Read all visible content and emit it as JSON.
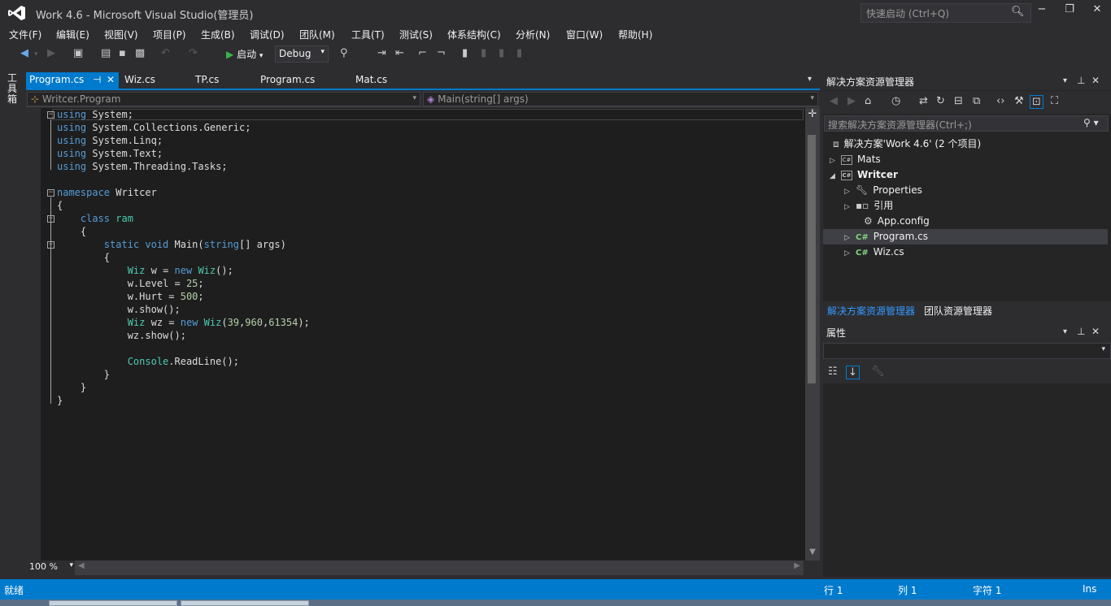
{
  "window": {
    "title": "Work 4.6 - Microsoft Visual Studio(管理员)",
    "quick_launch_placeholder": "快速启动 (Ctrl+Q)",
    "minimize": "−",
    "maximize": "❐",
    "close": "✕"
  },
  "menu": [
    "文件(F)",
    "编辑(E)",
    "视图(V)",
    "项目(P)",
    "生成(B)",
    "调试(D)",
    "团队(M)",
    "工具(T)",
    "测试(S)",
    "体系结构(C)",
    "分析(N)",
    "窗口(W)",
    "帮助(H)"
  ],
  "toolbar": {
    "start_label": "启动",
    "configuration": "Debug"
  },
  "toolbox_label": "工具箱",
  "tabs": [
    {
      "label": "Program.cs",
      "active": true
    },
    {
      "label": "Wiz.cs"
    },
    {
      "label": "TP.cs"
    },
    {
      "label": "Program.cs"
    },
    {
      "label": "Mat.cs"
    }
  ],
  "navbar": {
    "type": "Writcer.Program",
    "member": "Main(string[] args)"
  },
  "code": [
    "using System;",
    "using System.Collections.Generic;",
    "using System.Linq;",
    "using System.Text;",
    "using System.Threading.Tasks;",
    "",
    "namespace Writcer",
    "{",
    "    class Program",
    "    {",
    "        static void Main(string[] args)",
    "        {",
    "            Wiz w = new Wiz();",
    "            w.Level = 25;",
    "            w.Hurt = 500;",
    "            w.show();",
    "            Wiz wz = new Wiz(39,960,61354);",
    "            wz.show();",
    "",
    "            Console.ReadLine();",
    "        }",
    "    }",
    "}"
  ],
  "zoom": "100 %",
  "solution_explorer": {
    "title": "解决方案资源管理器",
    "search_placeholder": "搜索解决方案资源管理器(Ctrl+;)",
    "solution": "解决方案'Work 4.6' (2 个项目)",
    "items": [
      {
        "label": "Mats",
        "level": 1,
        "expander": "collapsed",
        "icon": "csharp-project-icon"
      },
      {
        "label": "Writcer",
        "level": 1,
        "expander": "expanded",
        "icon": "csharp-project-icon",
        "bold": true
      },
      {
        "label": "Properties",
        "level": 2,
        "expander": "collapsed",
        "icon": "wrench-icon"
      },
      {
        "label": "引用",
        "level": 2,
        "expander": "collapsed",
        "icon": "references-icon"
      },
      {
        "label": "App.config",
        "level": 2,
        "expander": "none",
        "icon": "config-file-icon"
      },
      {
        "label": "Program.cs",
        "level": 2,
        "expander": "collapsed",
        "icon": "csharp-file-icon",
        "selected": true
      },
      {
        "label": "Wiz.cs",
        "level": 2,
        "expander": "collapsed",
        "icon": "csharp-file-icon"
      }
    ],
    "bottom_tabs": [
      "解决方案资源管理器",
      "团队资源管理器"
    ]
  },
  "properties": {
    "title": "属性"
  },
  "status": {
    "ready": "就绪",
    "line": "行 1",
    "column": "列 1",
    "char": "字符 1",
    "mode": "Ins"
  },
  "colors": {
    "accent": "#007acc",
    "background": "#2d2d30",
    "editor": "#1e1e1e",
    "keyword": "#569cd6",
    "type": "#4ec9b0",
    "number": "#b5cea8"
  }
}
